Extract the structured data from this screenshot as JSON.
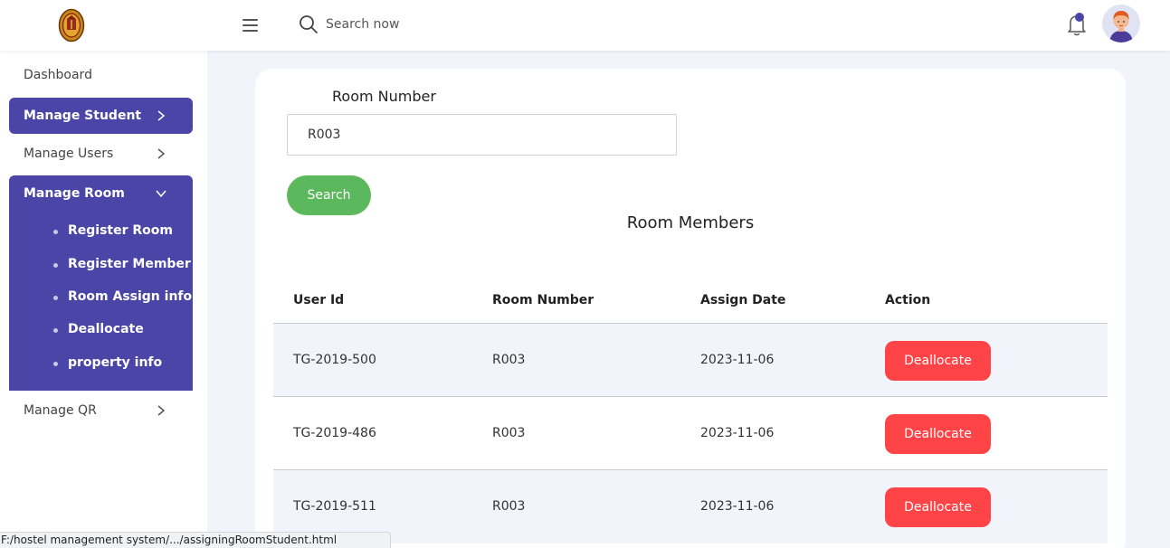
{
  "header": {
    "logo_icon": "university-crest-icon",
    "menu_icon": "hamburger-icon",
    "search_icon": "search-icon",
    "search_placeholder": "Search now",
    "notification_icon": "bell-icon",
    "avatar_icon": "user-avatar"
  },
  "sidebar": {
    "dashboard": "Dashboard",
    "manage_student": "Manage Student",
    "manage_users": "Manage Users",
    "manage_room": "Manage Room",
    "room_submenu": [
      "Register Room",
      "Register Member",
      "Room Assign info",
      "Deallocate",
      "property info"
    ],
    "manage_qr": "Manage QR"
  },
  "form": {
    "room_label": "Room Number",
    "room_value": "R003",
    "search_button": "Search"
  },
  "table": {
    "title": "Room Members",
    "columns": [
      "User Id",
      "Room Number",
      "Assign Date",
      "Action"
    ],
    "rows": [
      {
        "user_id": "TG-2019-500",
        "room": "R003",
        "date": "2023-11-06",
        "action": "Deallocate"
      },
      {
        "user_id": "TG-2019-486",
        "room": "R003",
        "date": "2023-11-06",
        "action": "Deallocate"
      },
      {
        "user_id": "TG-2019-511",
        "room": "R003",
        "date": "2023-11-06",
        "action": "Deallocate"
      }
    ]
  },
  "status_bar": "F:/hostel management system/.../assigningRoomStudent.html",
  "colors": {
    "primary": "#4b45a7",
    "success": "#5cb85c",
    "danger": "#ff4447",
    "background": "#f2f4fb"
  }
}
